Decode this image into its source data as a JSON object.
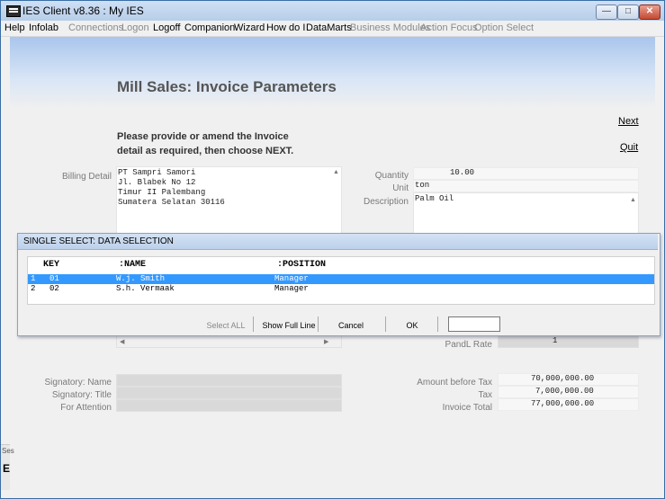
{
  "window": {
    "title": "IES Client v8.36 : My IES",
    "min": "—",
    "max": "□",
    "close": "✕"
  },
  "menu": [
    {
      "label": "Help",
      "enabled": true
    },
    {
      "label": "Infolab",
      "enabled": true
    },
    {
      "label": "Connections",
      "enabled": false
    },
    {
      "label": "Logon",
      "enabled": false
    },
    {
      "label": "Logoff",
      "enabled": true
    },
    {
      "label": "Companion",
      "enabled": true
    },
    {
      "label": "Wizard",
      "enabled": true
    },
    {
      "label": "How do I",
      "enabled": true
    },
    {
      "label": "DataMarts",
      "enabled": true
    },
    {
      "label": "Business Modules",
      "enabled": false
    },
    {
      "label": "Action Focus",
      "enabled": false
    },
    {
      "label": "Option Select",
      "enabled": false
    }
  ],
  "page": {
    "title": "Mill Sales: Invoice Parameters",
    "instructions_line1": "Please provide or amend the Invoice",
    "instructions_line2": "detail as required, then choose NEXT.",
    "next_link": "Next",
    "quit_link": "Quit"
  },
  "billing": {
    "label": "Billing Detail",
    "lines": [
      "PT Sampri Samori",
      "Jl. Blabek No 12",
      "Timur II Palembang",
      "Sumatera Selatan 30116"
    ]
  },
  "item": {
    "quantity_label": "Quantity",
    "quantity_value": "10.00",
    "unit_label": "Unit",
    "unit_value": "ton",
    "description_label": "Description",
    "description_value": "Palm Oil"
  },
  "dialog": {
    "title": "SINGLE SELECT: DATA SELECTION",
    "columns": [
      "KEY",
      ":NAME",
      ":POSITION"
    ],
    "rows": [
      {
        "num": "1",
        "key": "01",
        "name": "W.j. Smith",
        "position": "Manager",
        "selected": true
      },
      {
        "num": "2",
        "key": "02",
        "name": "S.h. Vermaak",
        "position": "Manager",
        "selected": false
      }
    ],
    "buttons": {
      "select_all": "Select ALL",
      "show_full_line": "Show Full Line",
      "cancel": "Cancel",
      "ok": "OK"
    },
    "filter_value": ""
  },
  "pandl": {
    "label": "PandL Rate",
    "value": "1"
  },
  "signatory": {
    "name_label": "Signatory: Name",
    "title_label": "Signatory: Title",
    "attention_label": "For Attention"
  },
  "totals": {
    "amount_before_tax_label": "Amount before Tax",
    "amount_before_tax_value": "70,000,000.00",
    "tax_label": "Tax",
    "tax_value": "7,000,000.00",
    "invoice_total_label": "Invoice Total",
    "invoice_total_value": "77,000,000.00"
  },
  "side_stub": {
    "text": "Ses",
    "glyph": "E"
  }
}
